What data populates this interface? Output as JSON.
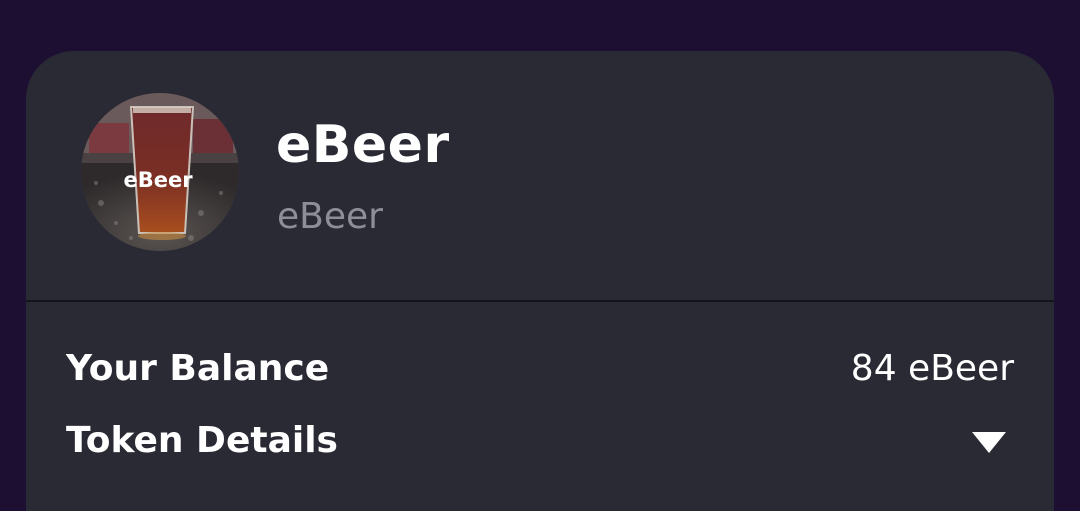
{
  "token": {
    "name": "eBeer",
    "symbol": "eBeer",
    "image_label": "eBeer"
  },
  "balance": {
    "label": "Your Balance",
    "value": "84 eBeer"
  },
  "details": {
    "label": "Token Details",
    "icon": "chevron-down-icon"
  },
  "colors": {
    "page_background": "#1c0f32",
    "card_background": "#2a2a35",
    "secondary_text": "#8e8e98"
  }
}
